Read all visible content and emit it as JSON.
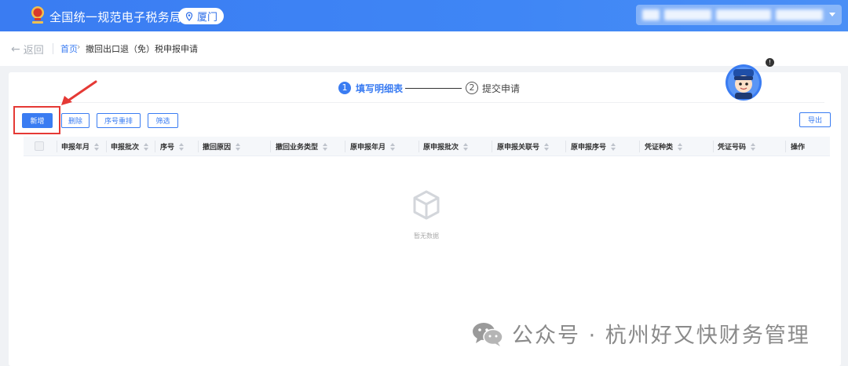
{
  "header": {
    "brand_title": "全国统一规范电子税务局",
    "city": "厦门",
    "user_name": ""
  },
  "breadcrumb": {
    "back_label": "返回",
    "home": "首页",
    "separator": "›",
    "current": "撤回出口退（免）税申报申请"
  },
  "steps": [
    {
      "num": "1",
      "label": "填写明细表",
      "active": true
    },
    {
      "num": "2",
      "label": "提交申请",
      "active": false
    }
  ],
  "toolbar": {
    "add_label": "新增",
    "delete_label": "删除",
    "reorder_label": "序号重排",
    "filter_label": "筛选",
    "export_label": "导出"
  },
  "table": {
    "columns": [
      "申报年月",
      "申报批次",
      "序号",
      "撤回原因",
      "撤回业务类型",
      "原申报年月",
      "原申报批次",
      "原申报关联号",
      "原申报序号",
      "凭证种类",
      "凭证号码",
      "操作"
    ],
    "rows": []
  },
  "empty_text": "暂无数据",
  "mascot_badge": "!",
  "watermark": "公众号 · 杭州好又快财务管理",
  "colors": {
    "primary": "#3a7cf2",
    "highlight": "#e53935",
    "header_bg": "#3f86f5"
  }
}
